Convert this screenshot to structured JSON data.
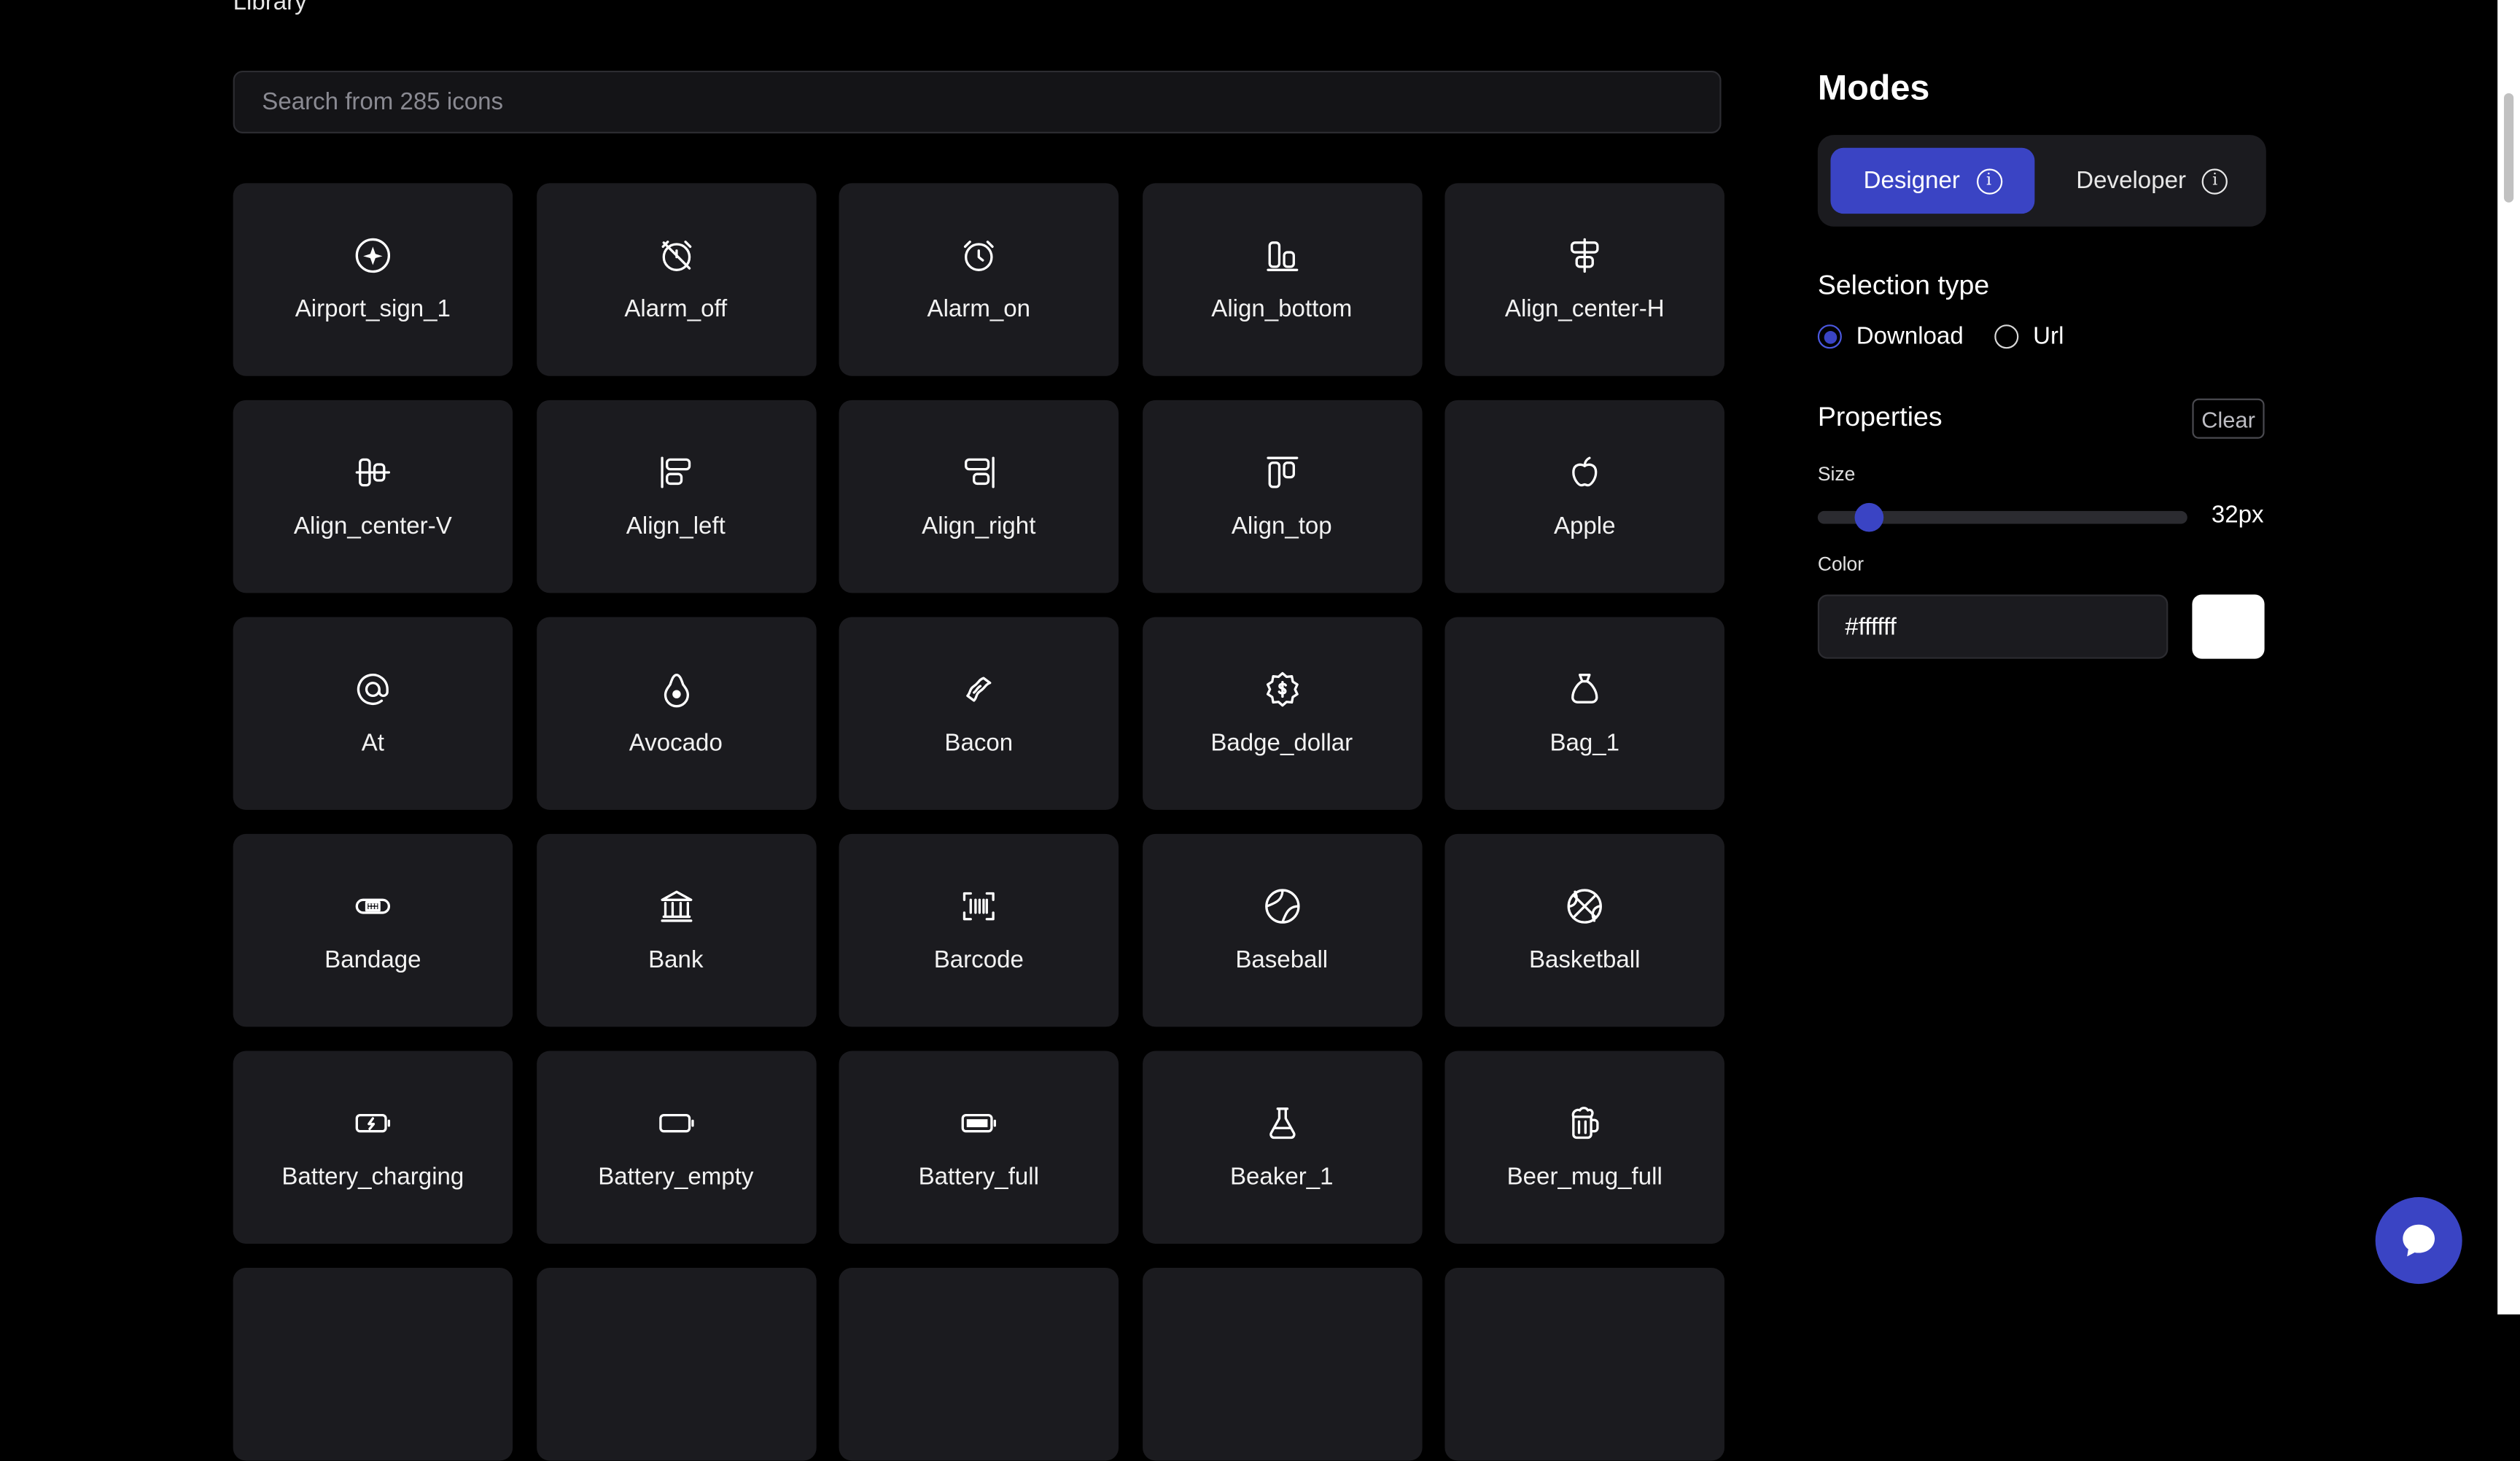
{
  "library": {
    "title": "Library"
  },
  "search": {
    "placeholder": "Search from 285 icons",
    "value": ""
  },
  "icons": [
    {
      "label": "Airport_sign_1",
      "icon": "airport-sign-icon"
    },
    {
      "label": "Alarm_off",
      "icon": "alarm-off-icon"
    },
    {
      "label": "Alarm_on",
      "icon": "alarm-on-icon"
    },
    {
      "label": "Align_bottom",
      "icon": "align-bottom-icon"
    },
    {
      "label": "Align_center-H",
      "icon": "align-center-h-icon"
    },
    {
      "label": "Align_center-V",
      "icon": "align-center-v-icon"
    },
    {
      "label": "Align_left",
      "icon": "align-left-icon"
    },
    {
      "label": "Align_right",
      "icon": "align-right-icon"
    },
    {
      "label": "Align_top",
      "icon": "align-top-icon"
    },
    {
      "label": "Apple",
      "icon": "apple-icon"
    },
    {
      "label": "At",
      "icon": "at-icon"
    },
    {
      "label": "Avocado",
      "icon": "avocado-icon"
    },
    {
      "label": "Bacon",
      "icon": "bacon-icon"
    },
    {
      "label": "Badge_dollar",
      "icon": "badge-dollar-icon"
    },
    {
      "label": "Bag_1",
      "icon": "bag-icon"
    },
    {
      "label": "Bandage",
      "icon": "bandage-icon"
    },
    {
      "label": "Bank",
      "icon": "bank-icon"
    },
    {
      "label": "Barcode",
      "icon": "barcode-icon"
    },
    {
      "label": "Baseball",
      "icon": "baseball-icon"
    },
    {
      "label": "Basketball",
      "icon": "basketball-icon"
    },
    {
      "label": "Battery_charging",
      "icon": "battery-charging-icon"
    },
    {
      "label": "Battery_empty",
      "icon": "battery-empty-icon"
    },
    {
      "label": "Battery_full",
      "icon": "battery-full-icon"
    },
    {
      "label": "Beaker_1",
      "icon": "beaker-icon"
    },
    {
      "label": "Beer_mug_full",
      "icon": "beer-mug-icon"
    }
  ],
  "modes": {
    "title": "Modes",
    "designer_label": "Designer",
    "developer_label": "Developer",
    "active": "Designer"
  },
  "selection": {
    "title": "Selection type",
    "options": [
      "Download",
      "Url"
    ],
    "selected": "Download"
  },
  "properties": {
    "title": "Properties",
    "clear_label": "Clear",
    "size_label": "Size",
    "size_value": "32px",
    "size_fraction": 0.14,
    "color_label": "Color",
    "color_value": "#ffffff"
  },
  "colors": {
    "accent": "#3a44c4",
    "background": "#000000",
    "card": "#1b1b1f"
  }
}
